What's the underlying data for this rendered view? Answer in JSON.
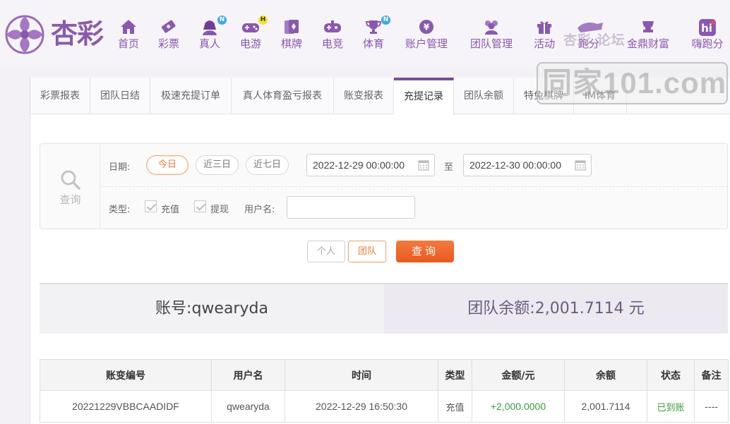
{
  "brand": {
    "name": "杏彩"
  },
  "nav": [
    {
      "label": "首页",
      "icon": "home-icon"
    },
    {
      "label": "彩票",
      "icon": "lottery-ticket-icon"
    },
    {
      "label": "真人",
      "icon": "live-dealer-icon",
      "badge": "N"
    },
    {
      "label": "电游",
      "icon": "gamepad-icon",
      "badge": "H"
    },
    {
      "label": "棋牌",
      "icon": "cards-icon"
    },
    {
      "label": "电竞",
      "icon": "esports-controller-icon"
    },
    {
      "label": "体育",
      "icon": "trophy-icon",
      "badge": "N"
    },
    {
      "label": "账户管理",
      "icon": "yen-coin-icon"
    },
    {
      "label": "团队管理",
      "icon": "team-icon"
    },
    {
      "label": "活动",
      "icon": "gift-icon"
    },
    {
      "label": "跑分",
      "icon": "running-icon"
    },
    {
      "label": "金鼎财富",
      "icon": "wealth-icon"
    },
    {
      "label": "嗨跑分",
      "icon": "hi-app-icon"
    }
  ],
  "watermark": {
    "top_text": "杏彩  论坛",
    "main_text": "同家101.com"
  },
  "tabs": [
    "彩票报表",
    "团队日结",
    "极速充提订单",
    "真人体育盈亏报表",
    "账变报表",
    "充提记录",
    "团队余额",
    "特兔棋牌",
    "IM体育"
  ],
  "active_tab": "充提记录",
  "filter": {
    "side_label": "查询",
    "date_label": "日期:",
    "quick_ranges": [
      "今日",
      "近三日",
      "近七日"
    ],
    "active_range": "今日",
    "start_date": "2022-12-29 00:00:00",
    "to_label": "至",
    "end_date": "2022-12-30 00:00:00",
    "type_label": "类型:",
    "types": [
      {
        "label": "充值",
        "checked": true
      },
      {
        "label": "提现",
        "checked": true
      }
    ],
    "username_label": "用户名:",
    "username_value": ""
  },
  "buttons": {
    "personal": "个人",
    "team": "团队",
    "query": "查询"
  },
  "summary": {
    "account_label": "账号:",
    "account": "qwearyda",
    "balance_label": "团队余额:",
    "balance": "2,001.7114",
    "unit": "元"
  },
  "table": {
    "headers": [
      "账变编号",
      "用户名",
      "时间",
      "类型",
      "金额/元",
      "余额",
      "状态",
      "备注"
    ],
    "rows": [
      {
        "id": "20221229VBBCAADIDF",
        "username": "qwearyda",
        "time": "2022-12-29 16:50:30",
        "type": "充值",
        "amount": "+2,000.0000",
        "balance": "2,001.7114",
        "status": "已到账",
        "note": "----"
      }
    ]
  },
  "colors": {
    "brand": "#8a58b0",
    "accent": "#e8793a",
    "success": "#3c9a3c"
  }
}
